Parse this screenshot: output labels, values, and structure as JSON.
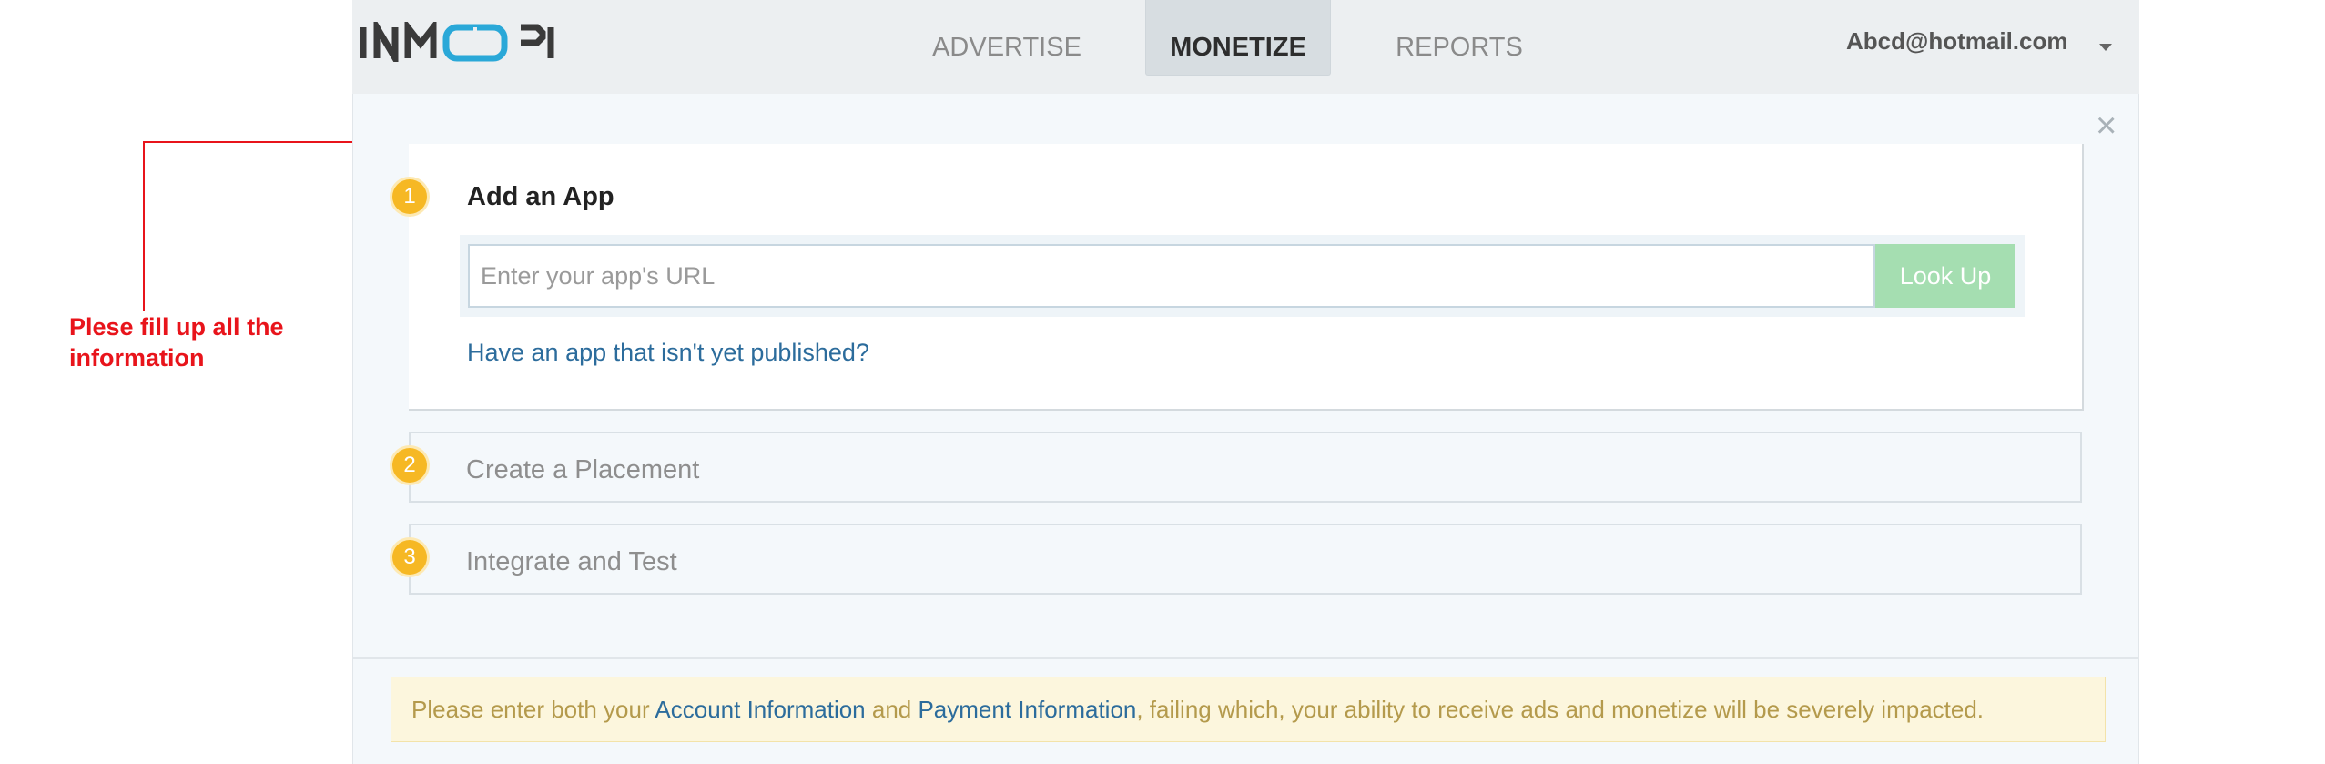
{
  "annotation": {
    "text": "Plese fill up all the information",
    "color": "#e8141b"
  },
  "header": {
    "logo_text": "INMOBI",
    "tabs": [
      {
        "label": "ADVERTISE",
        "active": false
      },
      {
        "label": "MONETIZE",
        "active": true
      },
      {
        "label": "REPORTS",
        "active": false
      }
    ],
    "user_email": "Abcd@hotmail.com",
    "user_menu_icon": "caret-down-icon"
  },
  "panel": {
    "close_icon": "close-icon",
    "steps": [
      {
        "number": "1",
        "title": "Add an App",
        "active": true
      },
      {
        "number": "2",
        "title": "Create a Placement",
        "active": false
      },
      {
        "number": "3",
        "title": "Integrate and Test",
        "active": false
      }
    ],
    "url_input": {
      "value": "",
      "placeholder": "Enter your app's URL"
    },
    "lookup_button": "Look Up",
    "unpublished_link": "Have an app that isn't yet published?"
  },
  "notice": {
    "prefix": "Please enter both your ",
    "account_link": "Account Information",
    "middle": " and ",
    "payment_link": "Payment Information",
    "suffix": ", failing which, your ability to receive ads and monetize will be severely impacted."
  },
  "colors": {
    "accent_step": "#f6b824",
    "lookup_button": "#a5deb1",
    "link": "#2c6c9c",
    "notice_bg": "#fcf6dd",
    "notice_text": "#b49a4c"
  }
}
